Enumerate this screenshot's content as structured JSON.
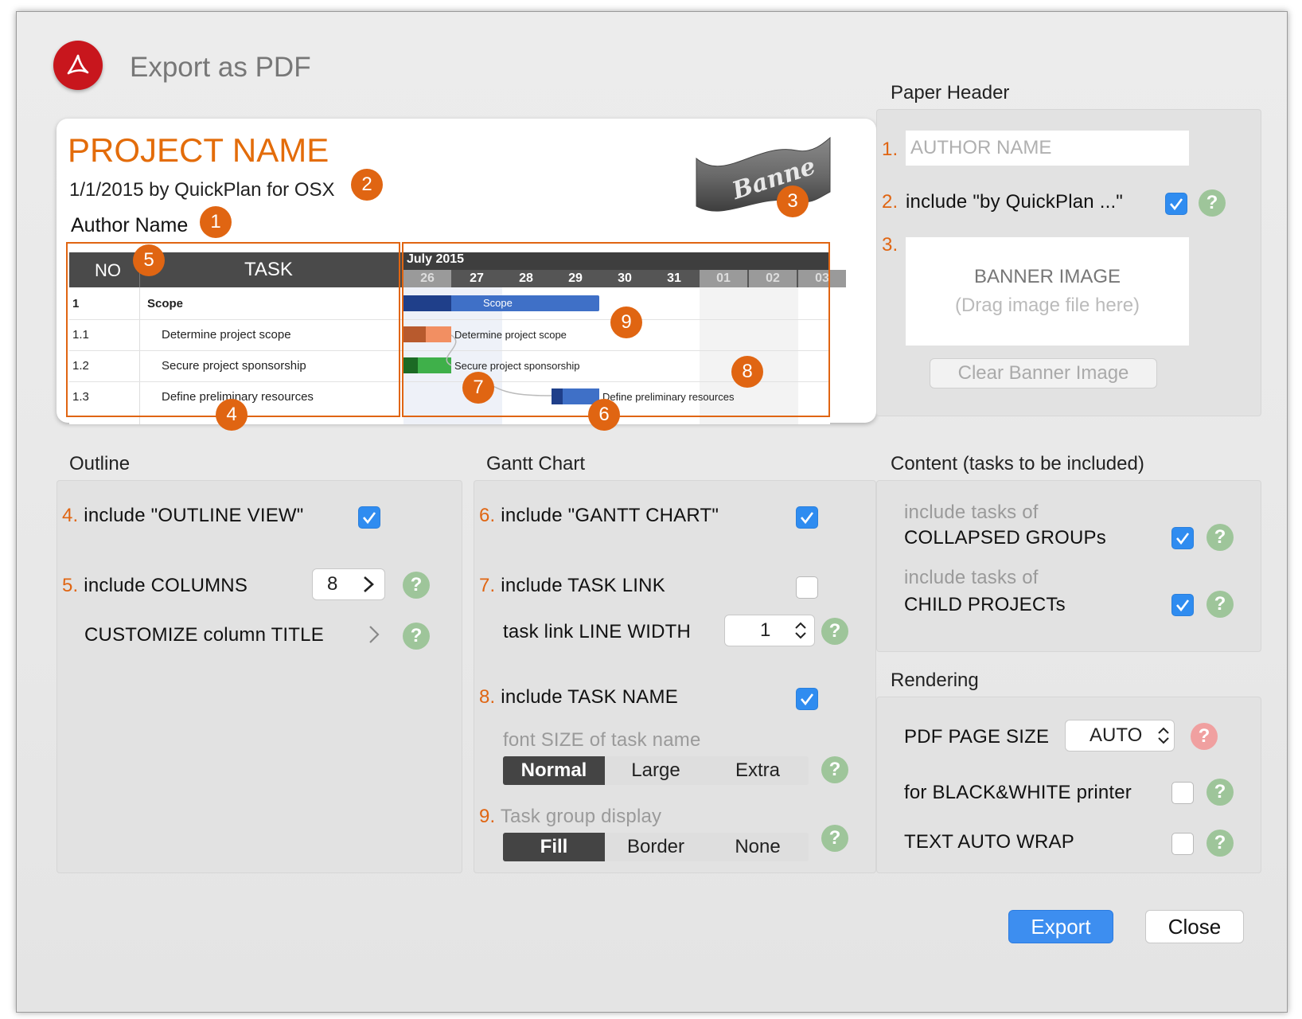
{
  "dialog": {
    "title": "Export as PDF"
  },
  "preview": {
    "project_name": "PROJECT NAME",
    "subtitle": "1/1/2015 by QuickPlan for OSX",
    "author": "Author Name",
    "banner_text": "Banne",
    "outline": {
      "headers": [
        "NO",
        "TASK"
      ],
      "rows": [
        {
          "no": "1",
          "task": "Scope"
        },
        {
          "no": "1.1",
          "task": "Determine project scope"
        },
        {
          "no": "1.2",
          "task": "Secure project sponsorship"
        },
        {
          "no": "1.3",
          "task": "Define preliminary resources"
        }
      ]
    },
    "gantt": {
      "month": "July 2015",
      "days": [
        "26",
        "27",
        "28",
        "29",
        "30",
        "31",
        "01",
        "02",
        "03"
      ],
      "bars": [
        {
          "label": "Scope"
        },
        {
          "label": "Determine project scope"
        },
        {
          "label": "Secure project sponsorship"
        },
        {
          "label": "Define preliminary resources"
        }
      ]
    },
    "badges": [
      "1",
      "2",
      "3",
      "4",
      "5",
      "6",
      "7",
      "8",
      "9"
    ]
  },
  "paper_header": {
    "title": "Paper Header",
    "n1": "1.",
    "n2": "2.",
    "n3": "3.",
    "author_placeholder": "AUTHOR NAME",
    "include_by_label": "include \"by QuickPlan ...\"",
    "include_by_checked": true,
    "banner_title": "BANNER IMAGE",
    "banner_hint": "(Drag image file here)",
    "clear_button": "Clear Banner Image"
  },
  "outline_section": {
    "title": "Outline",
    "n4": "4.",
    "n5": "5.",
    "include_outline_label": "include \"OUTLINE VIEW\"",
    "include_outline_checked": true,
    "include_columns_label": "include COLUMNS",
    "columns_value": "8",
    "customize_label": "CUSTOMIZE column TITLE"
  },
  "gantt_section": {
    "title": "Gantt Chart",
    "n6": "6.",
    "n7": "7.",
    "n8": "8.",
    "n9": "9.",
    "include_gantt_label": "include \"GANTT CHART\"",
    "include_gantt_checked": true,
    "include_link_label": "include TASK LINK",
    "include_link_checked": false,
    "line_width_label": "task link LINE WIDTH",
    "line_width_value": "1",
    "include_name_label": "include TASK NAME",
    "include_name_checked": true,
    "font_size_label": "font SIZE of task name",
    "font_sizes": [
      "Normal",
      "Large",
      "Extra"
    ],
    "font_size_selected": "Normal",
    "group_display_label": "Task group display",
    "group_displays": [
      "Fill",
      "Border",
      "None"
    ],
    "group_display_selected": "Fill"
  },
  "content_section": {
    "title": "Content (tasks to be included)",
    "collapsed_line1": "include tasks of",
    "collapsed_line2": "COLLAPSED GROUPs",
    "collapsed_checked": true,
    "child_line1": "include tasks of",
    "child_line2": "CHILD PROJECTs",
    "child_checked": true
  },
  "rendering_section": {
    "title": "Rendering",
    "page_size_label": "PDF PAGE SIZE",
    "page_size_value": "AUTO",
    "bw_label": "for BLACK&WHITE printer",
    "bw_checked": false,
    "wrap_label": "TEXT AUTO WRAP",
    "wrap_checked": false
  },
  "footer": {
    "export_button": "Export",
    "close_button": "Close"
  },
  "help_glyph": "?",
  "colors": {
    "accent": "#e06512",
    "blue": "#2f8cf0",
    "help_green": "#9ec59a",
    "help_red": "#f0a0a0"
  }
}
